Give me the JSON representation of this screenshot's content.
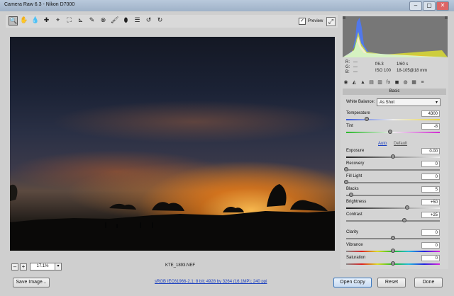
{
  "window": {
    "title": "Camera Raw 6.3  -  Nikon D7000",
    "minimize": "–",
    "maximize": "▢",
    "close": "✕"
  },
  "toolbar": {
    "tools": [
      "🔍",
      "✋",
      "💧",
      "✚",
      "⌖",
      "⛶",
      "⊾",
      "✎",
      "⊗",
      "🖌",
      "⬮",
      "☰",
      "↺",
      "↻"
    ],
    "preview_label": "Preview",
    "preview_checked": "✓",
    "fullscreen": "⤢"
  },
  "readout": {
    "r_label": "R:",
    "r_value": "---",
    "g_label": "G:",
    "g_value": "---",
    "b_label": "B:",
    "b_value": "---",
    "aperture": "f/6.3",
    "shutter": "1/60 s",
    "iso": "ISO 100",
    "lens": "18-105@18 mm"
  },
  "panel_icons": [
    "◉",
    "◭",
    "▲",
    "▤",
    "▥",
    "fx",
    "◼",
    "◍",
    "▦",
    "≡"
  ],
  "basic": {
    "header": "Basic",
    "white_balance_label": "White Balance:",
    "white_balance_value": "As Shot",
    "auto": "Auto",
    "default": "Default",
    "sliders": [
      {
        "label": "Temperature",
        "value": "4300",
        "position": 0.22
      },
      {
        "label": "Tint",
        "value": "-8",
        "position": 0.47
      },
      {
        "label": "Exposure",
        "value": "0.00",
        "position": 0.5
      },
      {
        "label": "Recovery",
        "value": "0",
        "position": 0.0
      },
      {
        "label": "Fill Light",
        "value": "0",
        "position": 0.0
      },
      {
        "label": "Blacks",
        "value": "5",
        "position": 0.05
      },
      {
        "label": "Brightness",
        "value": "+50",
        "position": 0.65
      },
      {
        "label": "Contrast",
        "value": "+25",
        "position": 0.62
      },
      {
        "label": "Clarity",
        "value": "0",
        "position": 0.5
      },
      {
        "label": "Vibrance",
        "value": "0",
        "position": 0.5
      },
      {
        "label": "Saturation",
        "value": "0",
        "position": 0.5
      }
    ]
  },
  "zoom": {
    "minus": "–",
    "plus": "+",
    "value": "17.1%",
    "dropdown": "▾"
  },
  "filename": "KTE_1893.NEF",
  "bottom": {
    "save_image": "Save Image...",
    "workflow": "sRGB IEC61966-2.1; 8 bit; 4928 by 3264 (16.1MP); 240 ppi",
    "open_copy": "Open Copy",
    "reset": "Reset",
    "done": "Done"
  },
  "colors": {
    "accent": "#3a78c0",
    "link": "#1a3fbf"
  }
}
